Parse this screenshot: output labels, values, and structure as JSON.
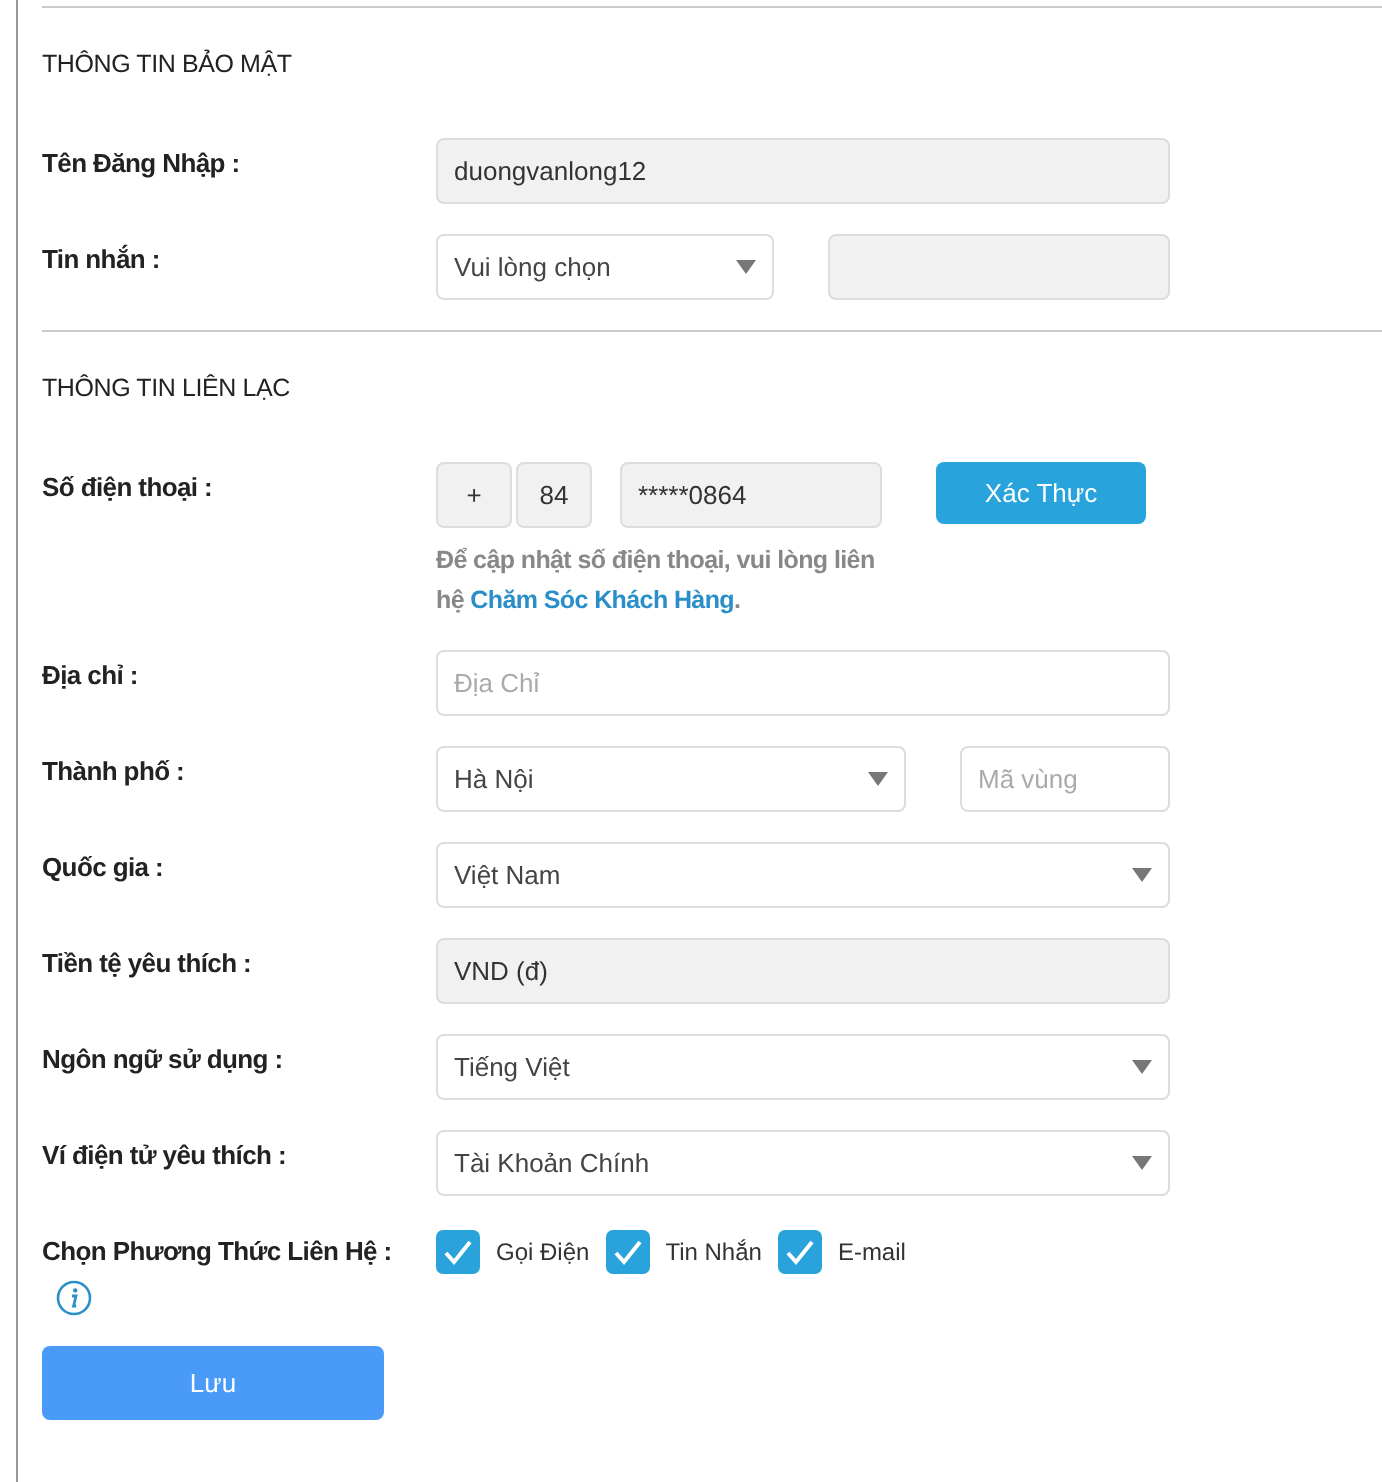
{
  "sections": [
    {
      "title": "THÔNG TIN BẢO MẬT",
      "rows": [
        {
          "label": "Tên Đăng Nhập :",
          "kind": "single",
          "controls": [
            {
              "kind": "readonly",
              "value": "duongvanlong12"
            }
          ]
        },
        {
          "label": "Tin nhắn :",
          "kind": "pair",
          "controls": [
            {
              "kind": "select",
              "value": "Vui lòng chọn"
            },
            {
              "kind": "readonly"
            }
          ]
        }
      ]
    },
    {
      "title": "THÔNG TIN LIÊN LẠC",
      "rows": [
        {
          "label": "Số điện thoại :",
          "kind": "phone",
          "controls": [
            {
              "kind": "readonly",
              "value": "+"
            },
            {
              "kind": "readonly",
              "value": "84"
            },
            {
              "kind": "readonly",
              "value": "*****0864"
            },
            {
              "kind": "button",
              "label": "Xác Thực"
            }
          ],
          "note": {
            "text": "Để cập nhật số điện thoại, vui lòng liên hệ",
            "link": "Chăm Sóc Khách Hàng",
            "end": "."
          }
        },
        {
          "label": "Địa chỉ :",
          "kind": "single",
          "controls": [
            {
              "kind": "input",
              "placeholder": "Địa Chỉ"
            }
          ]
        },
        {
          "label": "Thành phố :",
          "kind": "pair_wide",
          "controls": [
            {
              "kind": "select",
              "value": "Hà Nội"
            },
            {
              "kind": "input",
              "placeholder": "Mã vùng"
            }
          ]
        },
        {
          "label": "Quốc gia :",
          "kind": "single",
          "controls": [
            {
              "kind": "select",
              "value": "Việt Nam"
            }
          ]
        },
        {
          "label": "Tiền tệ yêu thích :",
          "kind": "single",
          "controls": [
            {
              "kind": "readonly",
              "value": "VND (đ)"
            }
          ]
        },
        {
          "label": "Ngôn ngữ sử dụng :",
          "kind": "single",
          "controls": [
            {
              "kind": "select",
              "value": "Tiếng Việt"
            }
          ]
        },
        {
          "label": "Ví điện tử yêu thích :",
          "kind": "single",
          "controls": [
            {
              "kind": "select",
              "value": "Tài Khoản Chính"
            }
          ]
        },
        {
          "label": "Chọn Phương Thức Liên Hệ :",
          "kind": "checkboxes",
          "info": true,
          "checkboxes": [
            {
              "label": "Gọi Điện",
              "checked": true
            },
            {
              "label": "Tin Nhắn",
              "checked": true
            },
            {
              "label": "E-mail",
              "checked": true
            }
          ]
        }
      ]
    }
  ],
  "save_button": "Lưu"
}
